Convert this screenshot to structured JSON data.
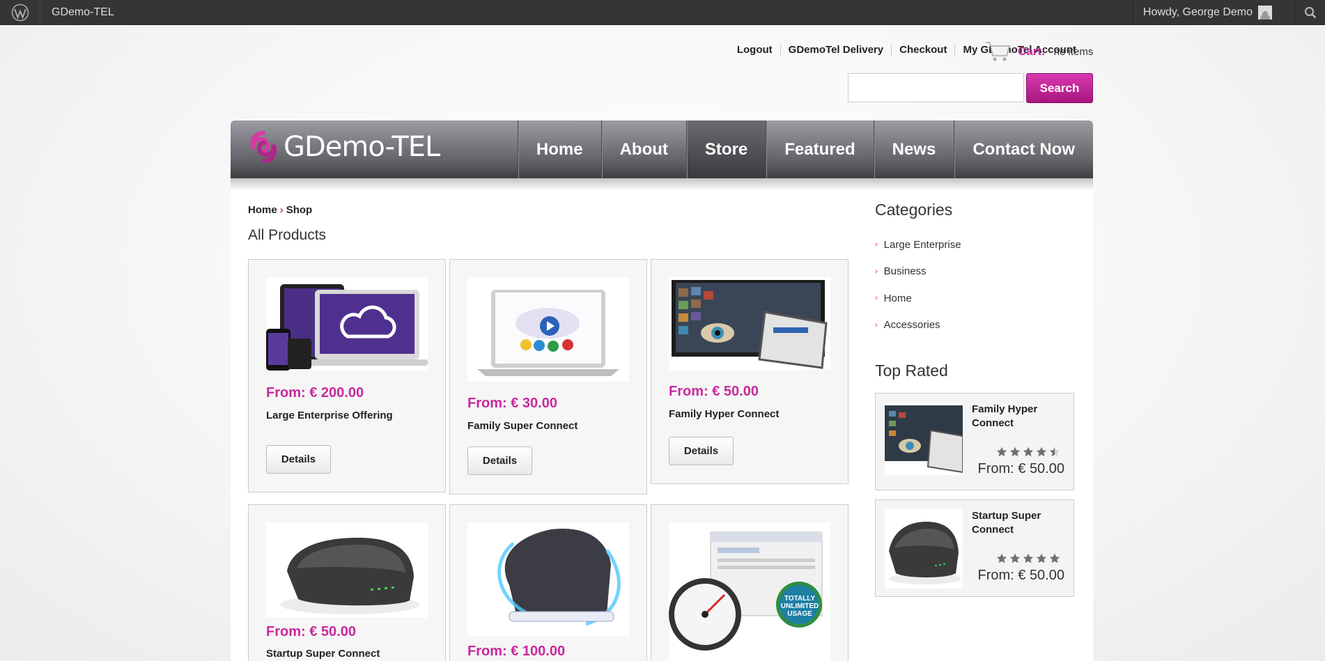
{
  "admin_bar": {
    "site_name": "GDemo-TEL",
    "greeting": "Howdy, George Demo"
  },
  "top_links": [
    "Logout",
    "GDemoTel Delivery",
    "Checkout",
    "My GDemoTel Account"
  ],
  "cart": {
    "label": "Cart:",
    "status": "no items"
  },
  "search": {
    "button": "Search",
    "value": ""
  },
  "brand": {
    "logo_text": "GDemo-TEL",
    "colors": {
      "accent": "#c8299c"
    }
  },
  "nav": {
    "items": [
      "Home",
      "About",
      "Store",
      "Featured",
      "News",
      "Contact Now"
    ],
    "active": "Store"
  },
  "breadcrumb": {
    "home": "Home",
    "separator": "›",
    "current": "Shop"
  },
  "page_title": "All Products",
  "products": [
    {
      "price": "From: € 200.00",
      "name": "Large Enterprise Offering",
      "button": "Details"
    },
    {
      "price": "From: € 30.00",
      "name": "Family Super Connect",
      "button": "Details"
    },
    {
      "price": "From: € 50.00",
      "name": "Family Hyper Connect",
      "button": "Details"
    },
    {
      "price": "From: € 50.00",
      "name": "Startup Super Connect",
      "button": ""
    },
    {
      "price": "From: € 100.00",
      "name": "",
      "button": ""
    },
    {
      "price": "",
      "name": "",
      "button": "",
      "badge": [
        "TOTALLY",
        "UNLIMITED",
        "USAGE"
      ]
    }
  ],
  "sidebar": {
    "categories_title": "Categories",
    "categories": [
      "Large Enterprise",
      "Business",
      "Home",
      "Accessories"
    ],
    "top_rated_title": "Top Rated",
    "top_rated": [
      {
        "name": "Family Hyper Connect",
        "price": "From: € 50.00",
        "rating": 4.5
      },
      {
        "name": "Startup Super Connect",
        "price": "From: € 50.00",
        "rating": 5
      }
    ]
  }
}
